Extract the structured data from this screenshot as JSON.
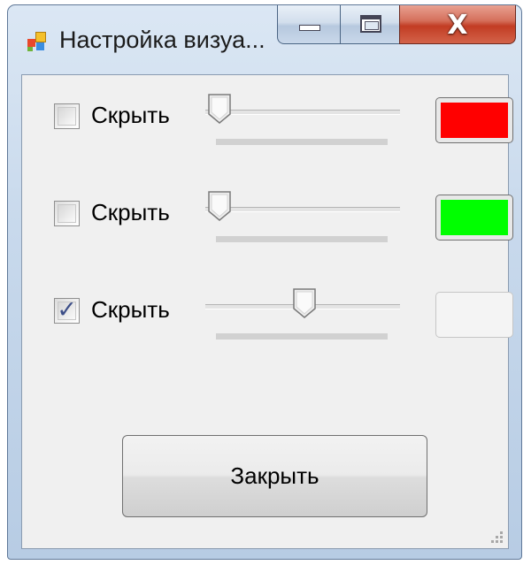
{
  "window": {
    "title": "Настройка визуа...",
    "icon": "app-icon",
    "controls": {
      "minimize": "minimize-icon",
      "maximize": "maximize-icon",
      "close_glyph": "X"
    }
  },
  "rows": [
    {
      "checkbox_label": "Скрыть",
      "checked": false,
      "slider_value": 0.0,
      "swatch_color": "#ff0000",
      "swatch_enabled": true
    },
    {
      "checkbox_label": "Скрыть",
      "checked": false,
      "slider_value": 0.0,
      "swatch_color": "#00ff00",
      "swatch_enabled": true
    },
    {
      "checkbox_label": "Скрыть",
      "checked": true,
      "slider_value": 0.5,
      "swatch_color": "#f4f4f4",
      "swatch_enabled": false
    }
  ],
  "footer": {
    "close_label": "Закрыть"
  },
  "colors": {
    "accent": "#3c4e88",
    "close_red": "#c23c23"
  }
}
